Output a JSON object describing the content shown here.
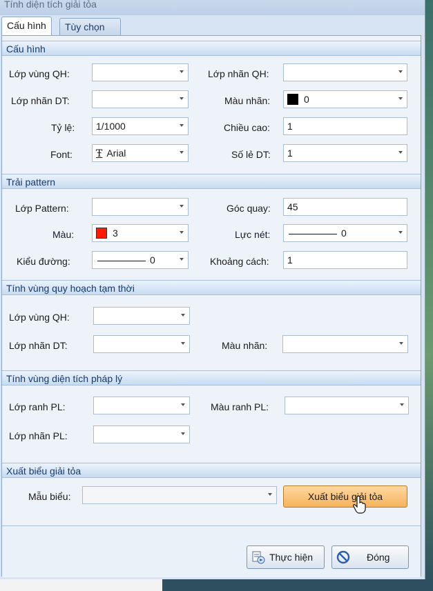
{
  "window": {
    "title": "Tính diện tích giải tỏa"
  },
  "tabs": [
    {
      "label": "Cấu hình"
    },
    {
      "label": "Tùy chọn"
    }
  ],
  "sections": {
    "cau_hinh": {
      "title": "Cấu hình",
      "lop_vung_qh": {
        "label": "Lớp vùng QH:",
        "value": ""
      },
      "lop_nhan_qh": {
        "label": "Lớp nhãn QH:",
        "value": ""
      },
      "lop_nhan_dt": {
        "label": "Lớp nhãn DT:",
        "value": ""
      },
      "mau_nhan": {
        "label": "Màu nhãn:",
        "value": "0",
        "color": "#000000"
      },
      "ty_le": {
        "label": "Tỷ lệ:",
        "value": "1/1000"
      },
      "chieu_cao": {
        "label": "Chiều cao:",
        "value": "1"
      },
      "font": {
        "label": "Font:",
        "value": "Arial",
        "icon": "truetype-font-icon"
      },
      "so_le_dt": {
        "label": "Số lẻ DT:",
        "value": "1"
      }
    },
    "trai_pattern": {
      "title": "Trải pattern",
      "lop_pattern": {
        "label": "Lớp Pattern:",
        "value": ""
      },
      "goc_quay": {
        "label": "Góc quay:",
        "value": "45"
      },
      "mau": {
        "label": "Màu:",
        "value": "3",
        "color": "#ff1a00"
      },
      "luc_net": {
        "label": "Lực nét:",
        "value": "0"
      },
      "kieu_duong": {
        "label": "Kiểu đường:",
        "value": "0"
      },
      "khoang_cach": {
        "label": "Khoảng cách:",
        "value": "1"
      }
    },
    "tinh_vung_tam_thoi": {
      "title": "Tính vùng quy hoạch tạm thời",
      "lop_vung_qh": {
        "label": "Lớp vùng QH:",
        "value": ""
      },
      "lop_nhan_dt": {
        "label": "Lớp nhãn DT:",
        "value": ""
      },
      "mau_nhan": {
        "label": "Màu nhãn:",
        "value": ""
      }
    },
    "tinh_vung_phap_ly": {
      "title": "Tính vùng diện tích pháp lý",
      "lop_ranh_pl": {
        "label": "Lớp ranh PL:",
        "value": ""
      },
      "mau_ranh_pl": {
        "label": "Màu ranh PL:",
        "value": ""
      },
      "lop_nhan_pl": {
        "label": "Lớp nhãn PL:",
        "value": ""
      }
    },
    "xuat_bieu": {
      "title": "Xuất biểu giải tỏa",
      "mau_bieu": {
        "label": "Mẫu biểu:",
        "value": ""
      },
      "export_button": "Xuất biểu giải tỏa"
    }
  },
  "buttons": {
    "thuc_hien": "Thực hiện",
    "dong": "Đóng"
  },
  "colors": {
    "header_text": "#153a6b",
    "export_button": "#f6b35c"
  }
}
